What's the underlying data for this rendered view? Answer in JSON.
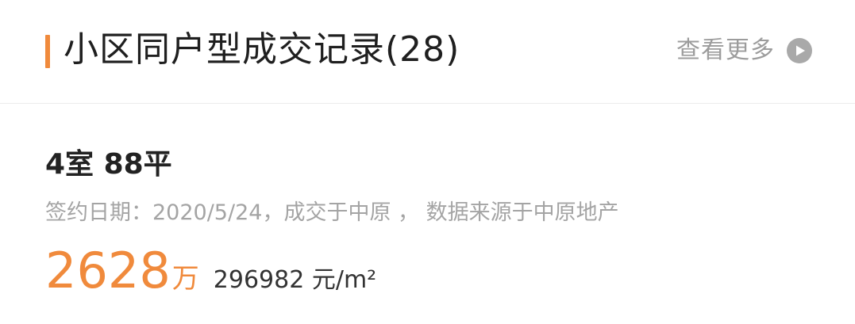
{
  "header": {
    "title": "小区同户型成交记录(28)",
    "more_label": "查看更多",
    "accent_color": "#f08a3c",
    "more_icon": "play-circle-icon"
  },
  "record": {
    "layout": "4室 88平",
    "meta": "签约日期：2020/5/24，成交于中原 ，  数据来源于中原地产",
    "total_price": "2628",
    "total_price_unit": "万",
    "unit_price": "296982 元/m²"
  }
}
